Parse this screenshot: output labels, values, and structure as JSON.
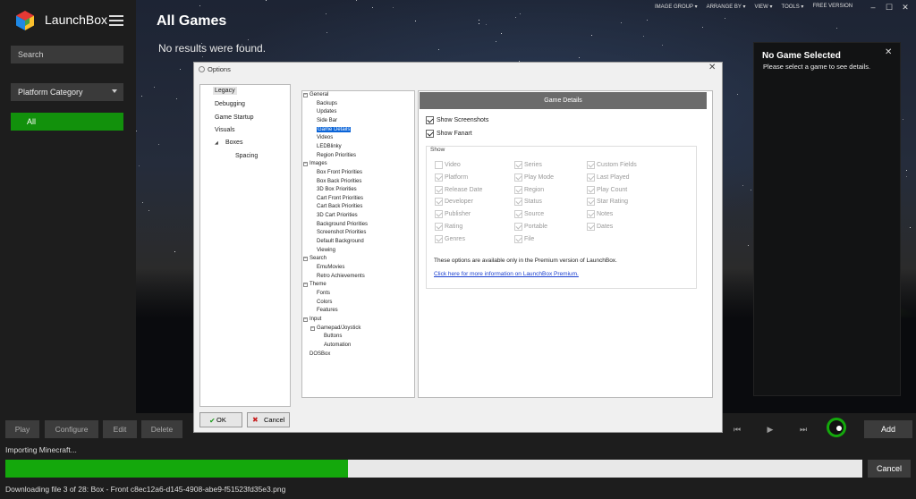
{
  "app": {
    "name": "LaunchBox"
  },
  "sidebar": {
    "search_placeholder": "Search",
    "platform_category": "Platform Category",
    "all_label": "All"
  },
  "header": {
    "title": "All Games",
    "no_results": "No results were found.",
    "menu": [
      "IMAGE GROUP ▾",
      "ARRANGE BY ▾",
      "VIEW ▾",
      "TOOLS ▾",
      "FREE VERSION"
    ]
  },
  "window_controls": {
    "minimize": "–",
    "maximize": "☐",
    "close": "✕"
  },
  "right_panel": {
    "title": "No Game Selected",
    "subtitle": "Please select a game to see details.",
    "close": "✕"
  },
  "toolbar": {
    "buttons": [
      "Play",
      "Configure",
      "Edit",
      "Delete"
    ],
    "media": [
      "⏮",
      "▶",
      "⏭"
    ],
    "add_label": "Add"
  },
  "status": {
    "importing": "Importing Minecraft...",
    "progress": 0.4,
    "cancel_label": "Cancel",
    "downloading": "Downloading file 3 of 28: Box - Front c8ec12a6-d145-4908-abe9-f51523fd35e3.png"
  },
  "dialog": {
    "title": "Options",
    "close": "✕",
    "left_nav": [
      "Legacy",
      "Debugging",
      "Game Startup",
      "Visuals",
      "Boxes",
      "Spacing"
    ],
    "tree": [
      "General",
      "Backups",
      "Updates",
      "Side Bar",
      "Game Details",
      "Videos",
      "LEDBlinky",
      "Region Priorities",
      "Images",
      "Box Front Priorities",
      "Box Back Priorities",
      "3D Box Priorities",
      "Cart Front Priorities",
      "Cart Back Priorities",
      "3D Cart Priorities",
      "Background Priorities",
      "Screenshot Priorities",
      "Default Background",
      "Viewing",
      "Search",
      "EmuMovies",
      "Retro Achievements",
      "Theme",
      "Fonts",
      "Colors",
      "Features",
      "Input",
      "Gamepad/Joystick",
      "Buttons",
      "Automation",
      "DOSBox"
    ],
    "selected_tree_item": "Game Details",
    "panel_header": "Game Details",
    "show_screenshots": "Show Screenshots",
    "show_fanart": "Show Fanart",
    "show_group_label": "Show",
    "show_fields": [
      [
        "Video",
        "Series",
        "Custom Fields"
      ],
      [
        "Platform",
        "Play Mode",
        "Last Played"
      ],
      [
        "Release Date",
        "Region",
        "Play Count"
      ],
      [
        "Developer",
        "Status",
        "Star Rating"
      ],
      [
        "Publisher",
        "Source",
        "Notes"
      ],
      [
        "Rating",
        "Portable",
        "Dates"
      ],
      [
        "Genres",
        "File",
        ""
      ]
    ],
    "show_checked": [
      [
        false,
        true,
        true
      ],
      [
        true,
        true,
        true
      ],
      [
        true,
        true,
        true
      ],
      [
        true,
        true,
        true
      ],
      [
        true,
        true,
        true
      ],
      [
        true,
        true,
        true
      ],
      [
        true,
        true,
        false
      ]
    ],
    "premium_note": "These options are available only in the Premium version of LaunchBox.",
    "premium_link": "Click here for more information on LaunchBox Premium.",
    "ok_label": "OK",
    "cancel_label": "Cancel"
  },
  "colors": {
    "accent": "#14a80c",
    "selection": "#0a64d8",
    "panel_header": "#6b6b6b"
  }
}
